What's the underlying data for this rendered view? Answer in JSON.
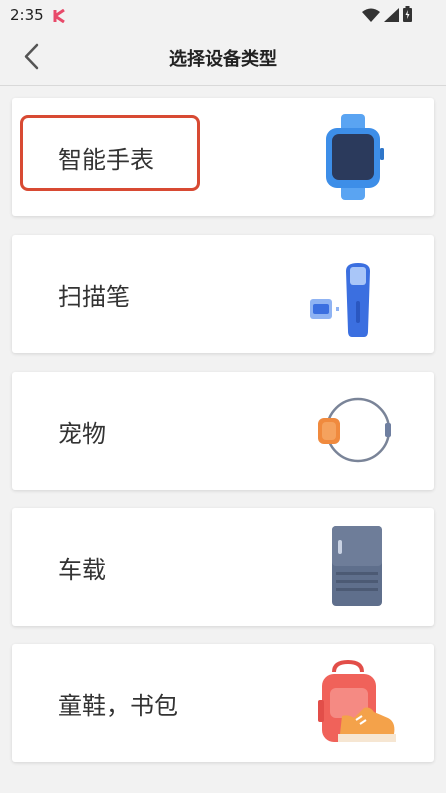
{
  "status_bar": {
    "time": "2:35"
  },
  "header": {
    "title": "选择设备类型"
  },
  "devices": [
    {
      "label": "智能手表",
      "icon": "smartwatch-icon",
      "highlighted": true
    },
    {
      "label": "扫描笔",
      "icon": "scanning-pen-icon"
    },
    {
      "label": "宠物",
      "icon": "pet-collar-icon"
    },
    {
      "label": "车载",
      "icon": "car-device-icon"
    },
    {
      "label": "童鞋，书包",
      "icon": "shoe-backpack-icon"
    }
  ],
  "colors": {
    "highlight": "#d84a33",
    "watch_blue": "#3d8ee8",
    "pen_blue": "#3b6fe0",
    "pet_orange": "#f08a3e",
    "car_slate": "#5f6f8c",
    "bag_red": "#f0625a"
  }
}
